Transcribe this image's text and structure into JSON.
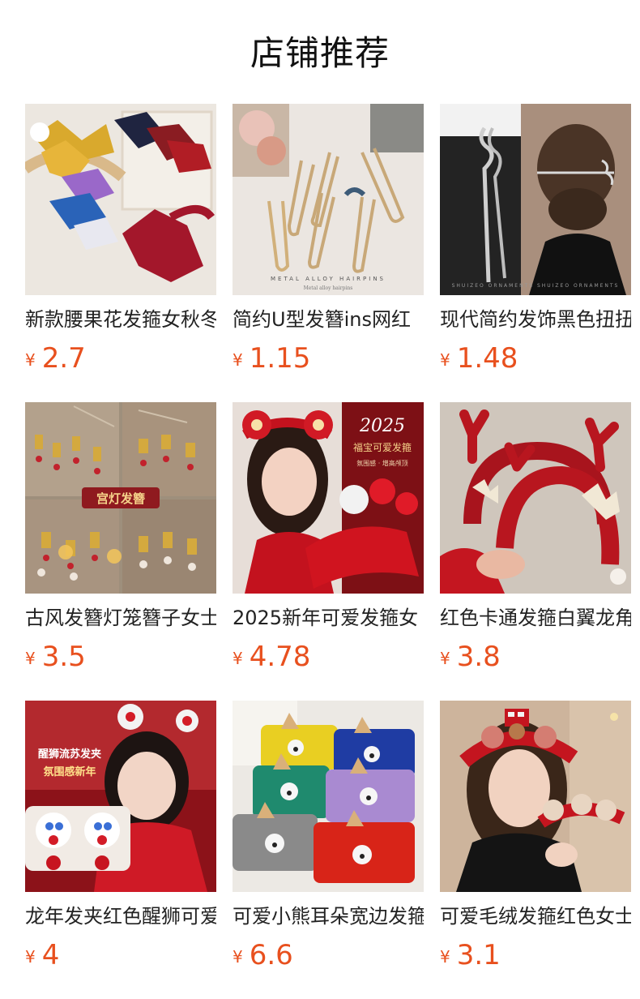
{
  "header": {
    "title": "店铺推荐"
  },
  "currency_symbol": "¥",
  "accent_color": "#e8501e",
  "products": [
    {
      "name": "新款腰果花发箍女秋冬",
      "price": "2.7"
    },
    {
      "name": "简约U型发簪ins网红",
      "price": "1.15"
    },
    {
      "name": "现代简约发饰黑色扭扭",
      "price": "1.48"
    },
    {
      "name": "古风发簪灯笼簪子女士",
      "price": "3.5"
    },
    {
      "name": "2025新年可爱发箍女",
      "price": "4.78"
    },
    {
      "name": "红色卡通发箍白翼龙角",
      "price": "3.8"
    },
    {
      "name": "龙年发夹红色醒狮可爱",
      "price": "4"
    },
    {
      "name": "可爱小熊耳朵宽边发箍",
      "price": "6.6"
    },
    {
      "name": "可爱毛绒发箍红色女士",
      "price": "3.1"
    }
  ],
  "image_text": {
    "p2": "METAL ALLOY HAIRPINS",
    "p2_sub": "Metal alloy hairpins",
    "p3": "SHUIZEO  ORNAMENTS  SHUIZEO  ORNAMENTS",
    "p4": "宫灯发簪",
    "p5_year": "2025",
    "p5_line1": "福宝可爱发箍",
    "p5_line2": "氛围感 · 增高颅顶",
    "p7_line1": "醒狮流苏发夹",
    "p7_line2": "氛围感新年"
  }
}
